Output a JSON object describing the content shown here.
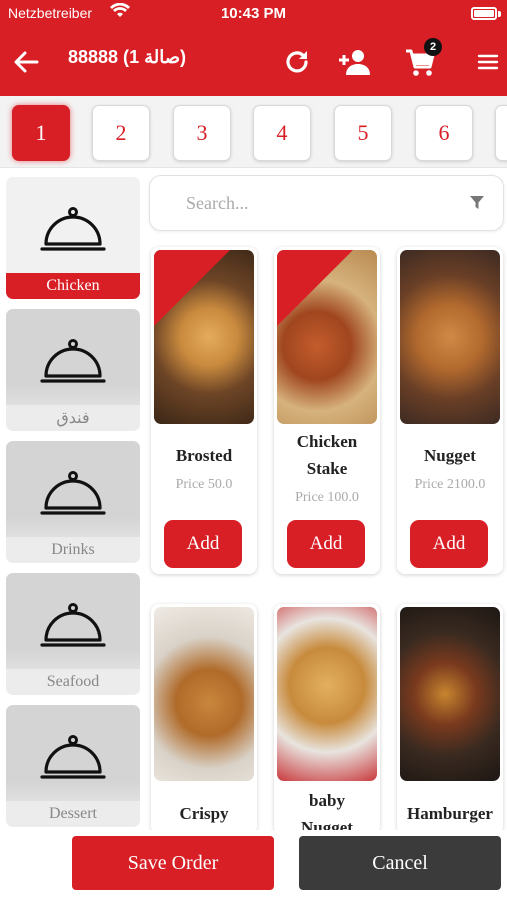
{
  "status_bar": {
    "carrier": "Netzbetreiber",
    "time": "10:43 PM"
  },
  "header": {
    "title": "88888 (صالة 1)",
    "cart_count": "2"
  },
  "tables": [
    "1",
    "2",
    "3",
    "4",
    "5",
    "6"
  ],
  "categories": [
    {
      "label": "Chicken"
    },
    {
      "label": "فندق"
    },
    {
      "label": "Drinks"
    },
    {
      "label": "Seafood"
    },
    {
      "label": "Dessert"
    }
  ],
  "search": {
    "placeholder": "Search..."
  },
  "products": [
    {
      "name_line1": "Brosted",
      "name_line2": "",
      "price": "Price 50.0",
      "add_label": "Add"
    },
    {
      "name_line1": "Chicken",
      "name_line2": "Stake",
      "price": "Price 100.0",
      "add_label": "Add"
    },
    {
      "name_line1": "Nugget",
      "name_line2": "",
      "price": "Price 2100.0",
      "add_label": "Add"
    },
    {
      "name_line1": "Crispy",
      "name_line2": ""
    },
    {
      "name_line1": "baby",
      "name_line2": "Nugget"
    },
    {
      "name_line1": "Hamburger",
      "name_line2": ""
    }
  ],
  "footer": {
    "save_label": "Save Order",
    "cancel_label": "Cancel"
  },
  "colors": {
    "accent": "#d81f26",
    "cancel": "#3b3b3b"
  }
}
